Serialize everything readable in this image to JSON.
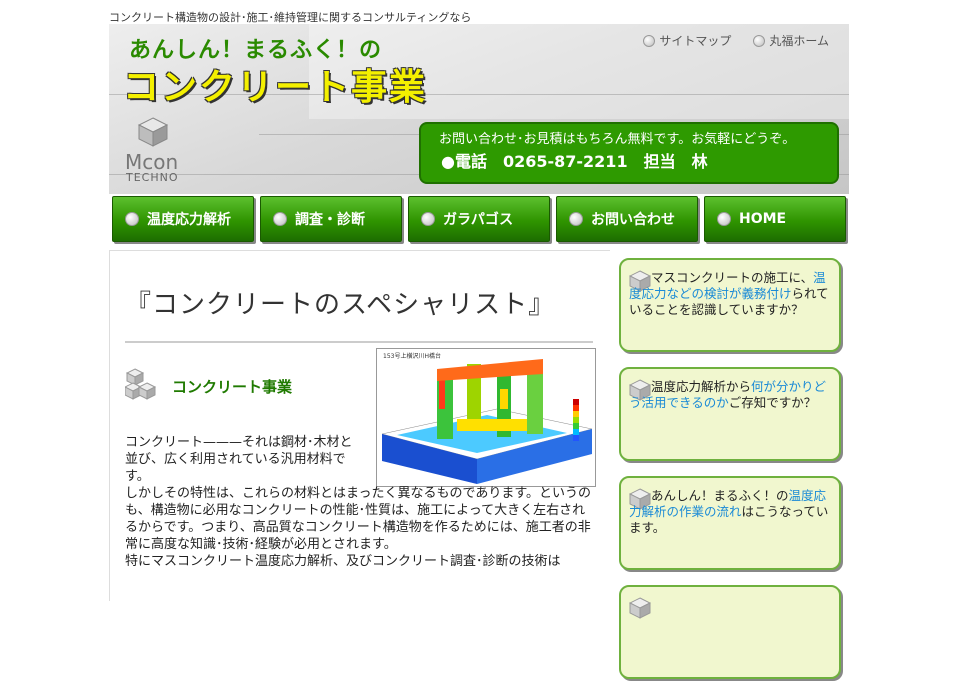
{
  "tagline": "コンクリート構造物の設計･施工･維持管理に関するコンサルティングなら",
  "header": {
    "subtitle": "あんしん！まるふく！の",
    "title": "コンクリート事業",
    "links": [
      {
        "label": "サイトマップ"
      },
      {
        "label": "丸福ホーム"
      }
    ],
    "logo": {
      "name": "Mcon",
      "sub": "TECHNO"
    },
    "contact": {
      "line1": "お問い合わせ･お見積はもちろん無料です。お気軽にどうぞ。",
      "line2": "●電話　0265-87-2211　担当　林"
    }
  },
  "nav": [
    {
      "label": "温度応力解析"
    },
    {
      "label": "調査・診断"
    },
    {
      "label": "ガラパゴス"
    },
    {
      "label": "お問い合わせ"
    },
    {
      "label": "HOME"
    }
  ],
  "main": {
    "title": "『コンクリートのスペシャリスト』",
    "section_title": "コンクリート事業",
    "figure_caption": "153号上横沢川H橋台",
    "paragraphs": [
      "コンクリート———それは鋼材･木材と並び、広く利用されている汎用材料です。",
      "しかしその特性は、これらの材料とはまったく異なるものであります。というのも、構造物に必用なコンクリートの性能･性質は、施工によって大きく左右されるからです。つまり、高品質なコンクリート構造物を作るためには、施工者の非常に高度な知識･技術･経験が必用とされます。",
      "特にマスコンクリート温度応力解析、及びコンクリート調査･診断の技術は"
    ]
  },
  "sidebar": {
    "cards": [
      {
        "pre": "マスコンクリートの施工に、",
        "link": "温度応力などの検討が義務付け",
        "post": "られていることを認識していますか？"
      },
      {
        "pre": "温度応力解析から",
        "link": "何が分かりどう活用できるのか",
        "post": "ご存知ですか？"
      },
      {
        "pre": "あんしん！まるふく！の",
        "link": "温度応力解析の作業の流れ",
        "post": "はこうなっています。"
      },
      {
        "pre": "",
        "link": "",
        "post": ""
      }
    ]
  },
  "colors": {
    "green": "#2e9a00",
    "title_yellow": "#f4f000",
    "link_blue": "#1a8ad6",
    "card_bg": "#f1f7cf"
  }
}
